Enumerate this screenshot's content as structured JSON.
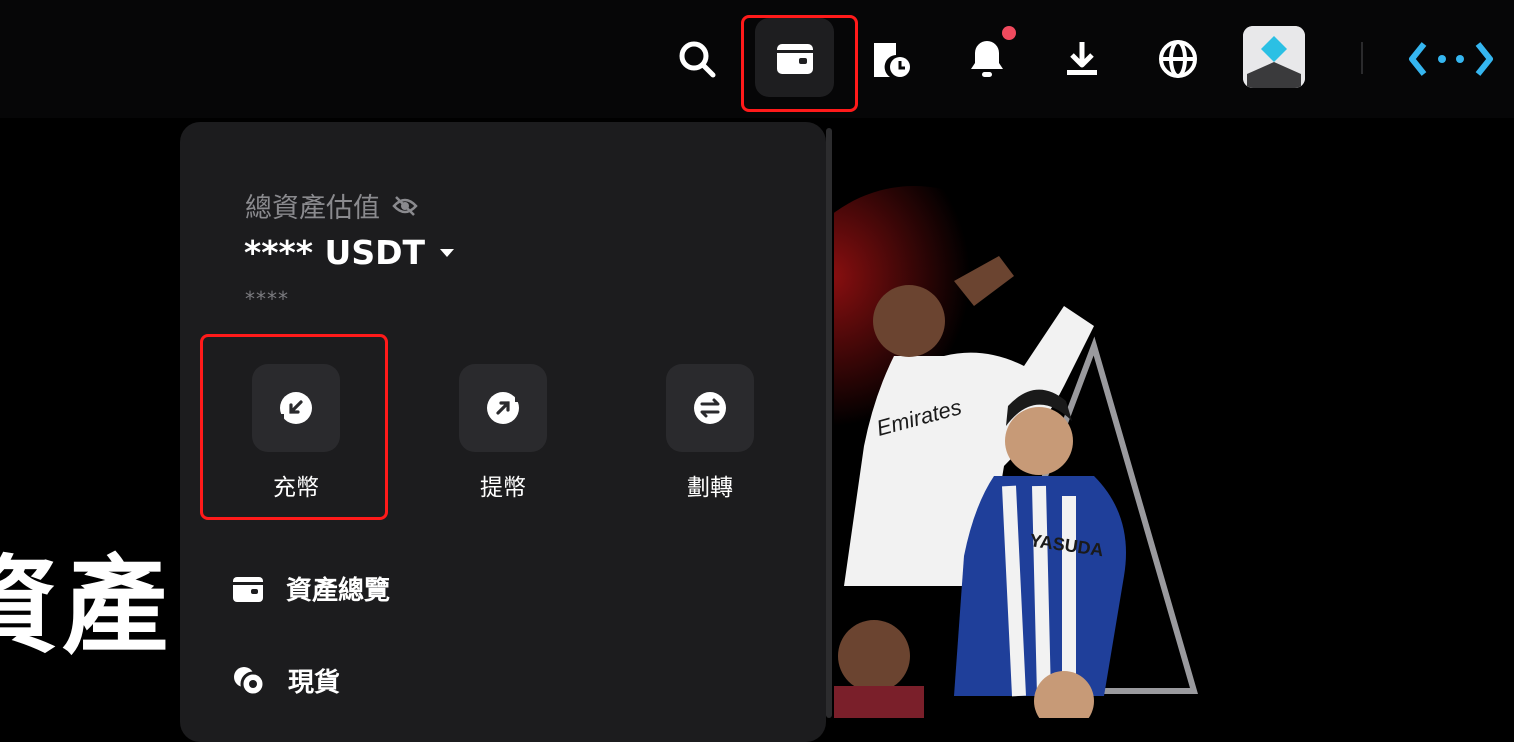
{
  "header": {
    "icons": [
      "search-icon",
      "wallet-icon",
      "order-history-icon",
      "bell-icon",
      "download-icon",
      "globe-icon",
      "avatar",
      "logo-icon"
    ],
    "notification_dot_color": "#f04a5e"
  },
  "background": {
    "page_heading": "資產"
  },
  "dropdown": {
    "total_assets_label": "總資產估值",
    "total_assets_value": "**** USDT",
    "total_assets_sub": "****",
    "actions": [
      {
        "label": "充幣",
        "icon": "deposit-icon"
      },
      {
        "label": "提幣",
        "icon": "withdraw-icon"
      },
      {
        "label": "劃轉",
        "icon": "transfer-icon"
      }
    ],
    "menu": [
      {
        "label": "資產總覽",
        "icon": "wallet-icon"
      },
      {
        "label": "現貨",
        "icon": "spot-coins-icon"
      }
    ]
  },
  "banner": {
    "sponsor_text": "Emirates",
    "sponsor_text_2": "YASUDA"
  },
  "colors": {
    "annotation": "#ff1a1a",
    "logo": "#35b6f0",
    "dropdown_bg": "#1c1c1e"
  }
}
